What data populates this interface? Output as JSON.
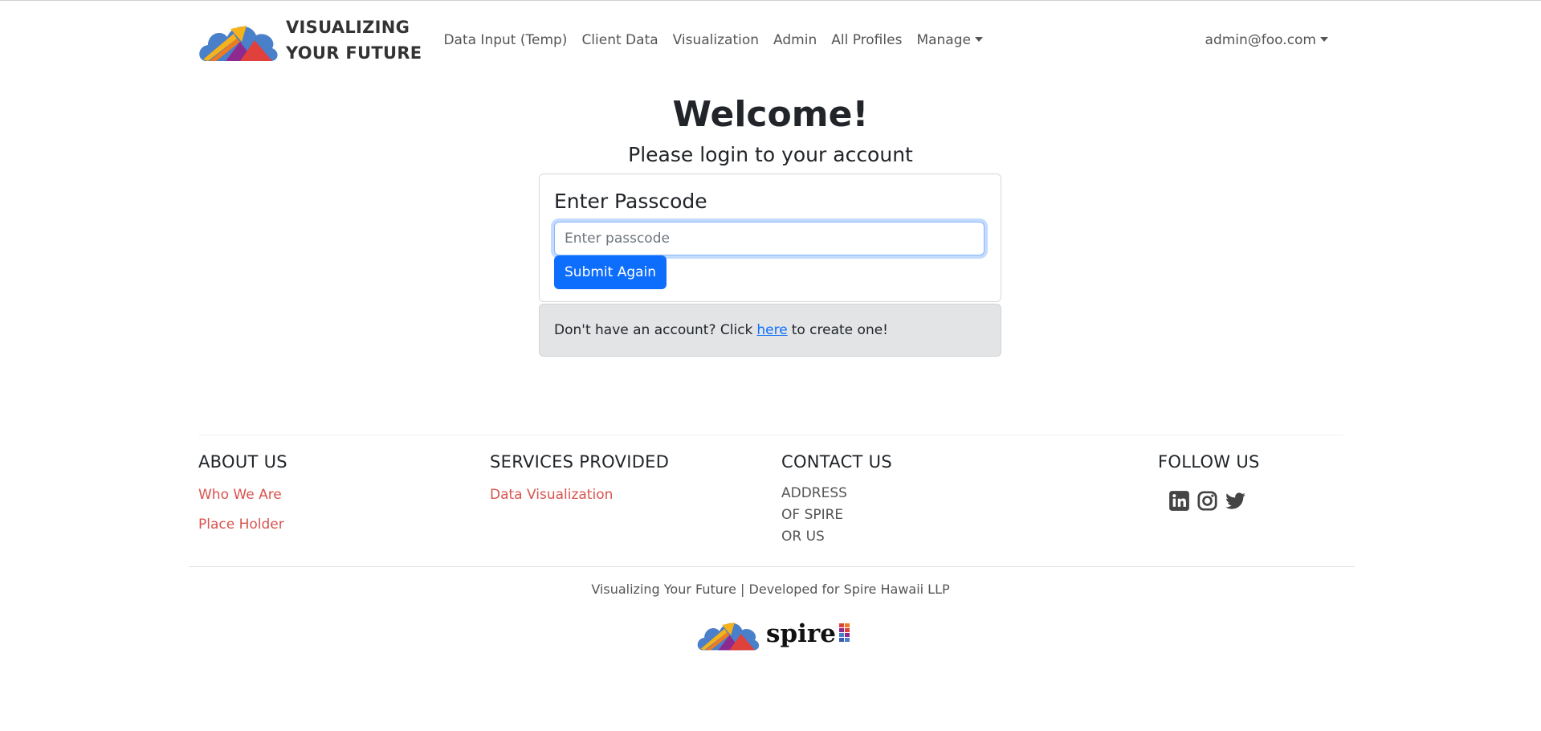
{
  "brand": {
    "line1": "VISUALIZING",
    "line2": "YOUR FUTURE"
  },
  "nav": {
    "items": [
      {
        "label": "Data Input (Temp)"
      },
      {
        "label": "Client Data"
      },
      {
        "label": "Visualization"
      },
      {
        "label": "Admin"
      },
      {
        "label": "All Profiles"
      }
    ],
    "manage_label": "Manage",
    "user_label": "admin@foo.com"
  },
  "main": {
    "title": "Welcome!",
    "subtitle": "Please login to your account",
    "card": {
      "title": "Enter Passcode",
      "input_placeholder": "Enter passcode",
      "input_value": "",
      "submit_label": "Submit Again"
    },
    "signup": {
      "prefix": "Don't have an account? Click",
      "link_label": "here",
      "suffix": "to create one!"
    }
  },
  "footer": {
    "about": {
      "heading": "ABOUT US",
      "links": [
        "Who We Are",
        "Place Holder"
      ]
    },
    "services": {
      "heading": "SERVICES PROVIDED",
      "links": [
        "Data Visualization"
      ]
    },
    "contact": {
      "heading": "CONTACT US",
      "address": [
        "ADDRESS",
        "OF SPIRE",
        "OR US"
      ]
    },
    "follow": {
      "heading": "FOLLOW US",
      "icons": [
        "linkedin-icon",
        "instagram-icon",
        "twitter-icon"
      ]
    },
    "credit": "Visualizing Your Future | Developed for Spire Hawaii LLP",
    "partner_word": "spire"
  },
  "colors": {
    "primary": "#0d6efd",
    "footer_link": "#d9534f",
    "card_footer_bg": "#e3e4e6"
  }
}
